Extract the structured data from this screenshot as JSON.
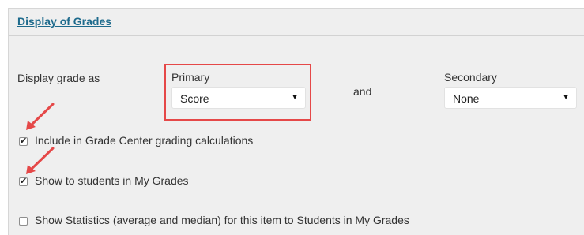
{
  "section": {
    "title": "Display of Grades"
  },
  "display_grade": {
    "row_label": "Display grade as",
    "primary": {
      "label": "Primary",
      "value": "Score"
    },
    "connector": "and",
    "secondary": {
      "label": "Secondary",
      "value": "None"
    }
  },
  "options": [
    {
      "label": "Include in Grade Center grading calculations",
      "checked": true
    },
    {
      "label": "Show to students in My Grades",
      "checked": true
    },
    {
      "label": "Show Statistics (average and median) for this item to Students in My Grades",
      "checked": false
    }
  ],
  "colors": {
    "highlight": "#e54848",
    "link": "#1d6a8c",
    "panel_bg": "#efefef"
  },
  "icons": {
    "dropdown": "caret-down-icon",
    "annotation": "red-arrow-icon"
  }
}
